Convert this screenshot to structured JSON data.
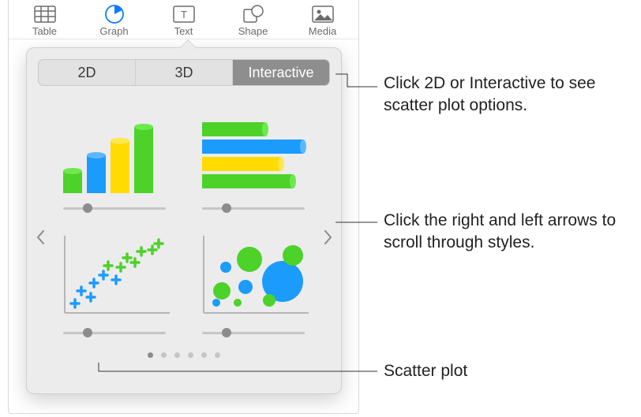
{
  "toolbar": {
    "items": [
      {
        "label": "Table",
        "name": "table-tool",
        "active": false
      },
      {
        "label": "Graph",
        "name": "graph-tool",
        "active": true
      },
      {
        "label": "Text",
        "name": "text-tool",
        "active": false
      },
      {
        "label": "Shape",
        "name": "shape-tool",
        "active": false
      },
      {
        "label": "Media",
        "name": "media-tool",
        "active": false
      }
    ]
  },
  "popover": {
    "segments": [
      "2D",
      "3D",
      "Interactive"
    ],
    "selected_segment": "Interactive",
    "thumbnails": [
      {
        "name": "column-chart-thumb",
        "kind": "column"
      },
      {
        "name": "bar-chart-thumb",
        "kind": "bar"
      },
      {
        "name": "scatter-plot-thumb",
        "kind": "scatter"
      },
      {
        "name": "bubble-chart-thumb",
        "kind": "bubble"
      }
    ],
    "page_count": 6,
    "current_page": 1
  },
  "callouts": {
    "c1": "Click 2D or Interactive to see scatter plot options.",
    "c2": "Click the right and left arrows to scroll through styles.",
    "c3": "Scatter plot"
  },
  "colors": {
    "green": "#4cd229",
    "blue": "#1b9cfc",
    "yellow": "#ffdb00"
  }
}
